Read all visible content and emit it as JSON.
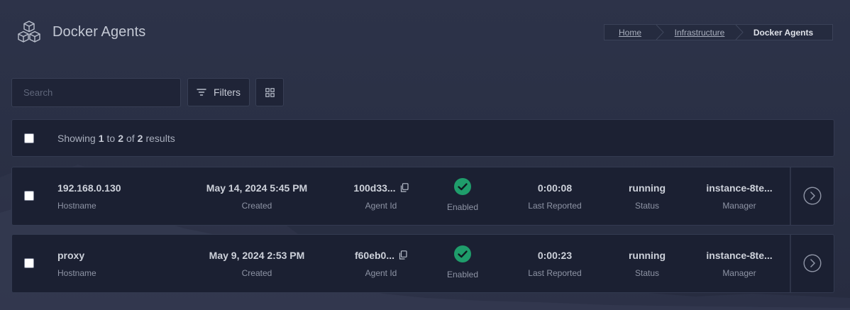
{
  "header": {
    "title": "Docker Agents",
    "logo_icon": "cubes-icon"
  },
  "breadcrumb": {
    "items": [
      {
        "label": "Home"
      },
      {
        "label": "Infrastructure"
      },
      {
        "label": "Docker Agents"
      }
    ]
  },
  "toolbar": {
    "search_placeholder": "Search",
    "search_value": "",
    "filters_label": "Filters",
    "filters_icon": "filter-lines-icon",
    "grid_icon": "grid-view-icon"
  },
  "summary": {
    "prefix": "Showing",
    "from": "1",
    "to_word": "to",
    "to": "2",
    "of_word": "of",
    "total": "2",
    "suffix": "results"
  },
  "rows": [
    {
      "hostname": "192.168.0.130",
      "hostname_label": "Hostname",
      "created": "May 14, 2024 5:45 PM",
      "created_label": "Created",
      "agent_id": "100d33...",
      "agent_id_label": "Agent Id",
      "enabled_label": "Enabled",
      "last_reported": "0:00:08",
      "last_reported_label": "Last Reported",
      "status": "running",
      "status_label": "Status",
      "manager": "instance-8te...",
      "manager_label": "Manager"
    },
    {
      "hostname": "proxy",
      "hostname_label": "Hostname",
      "created": "May 9, 2024 2:53 PM",
      "created_label": "Created",
      "agent_id": "f60eb0...",
      "agent_id_label": "Agent Id",
      "enabled_label": "Enabled",
      "last_reported": "0:00:23",
      "last_reported_label": "Last Reported",
      "status": "running",
      "status_label": "Status",
      "manager": "instance-8te...",
      "manager_label": "Manager"
    }
  ],
  "colors": {
    "enabled_green": "#1f9d6b",
    "background": "#2a3045",
    "panel": "#1b2032"
  }
}
